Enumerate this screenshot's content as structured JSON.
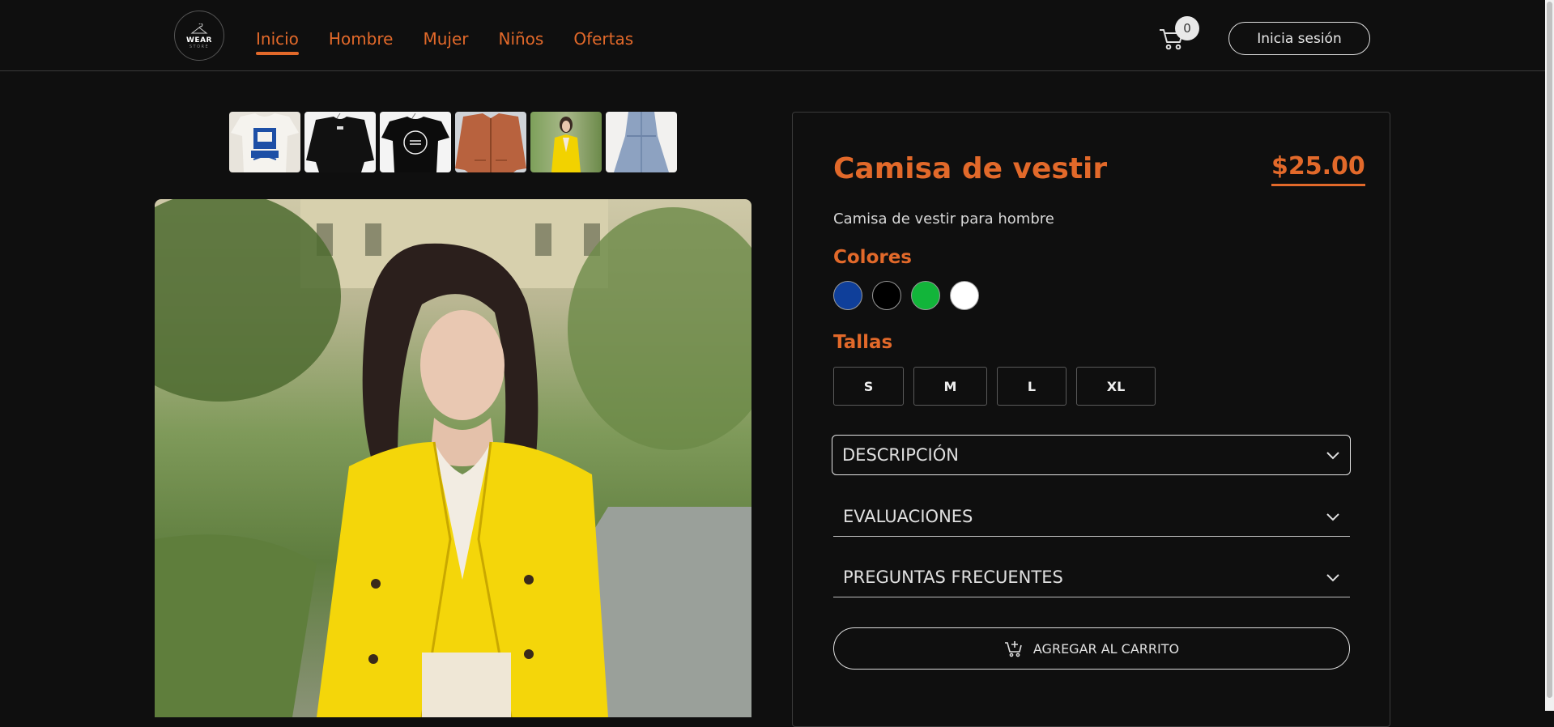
{
  "header": {
    "logo": {
      "brand": "WEAR",
      "sub": "STORE"
    },
    "nav": [
      {
        "label": "Inicio",
        "active": true
      },
      {
        "label": "Hombre",
        "active": false
      },
      {
        "label": "Mujer",
        "active": false
      },
      {
        "label": "Niños",
        "active": false
      },
      {
        "label": "Ofertas",
        "active": false
      }
    ],
    "cart_count": "0",
    "login_label": "Inicia sesión"
  },
  "gallery": {
    "thumbnails": [
      "white-tshirt-original",
      "black-sweater",
      "black-tshirt-705",
      "orange-bomber-jacket",
      "yellow-blazer-woman",
      "denim-dress"
    ],
    "main_image": "woman-yellow-blazer-photo"
  },
  "product": {
    "title": "Camisa de vestir",
    "price": "$25.00",
    "description": "Camisa de vestir para hombre",
    "colors_label": "Colores",
    "colors": [
      "#0f3f9a",
      "#000000",
      "#12b53a",
      "#ffffff"
    ],
    "sizes_label": "Tallas",
    "sizes": [
      "S",
      "M",
      "L",
      "XL"
    ],
    "accordions": [
      {
        "label": "DESCRIPCIÓN"
      },
      {
        "label": "EVALUACIONES"
      },
      {
        "label": "PREGUNTAS FRECUENTES"
      }
    ],
    "add_to_cart": "AGREGAR AL CARRITO"
  },
  "theme": {
    "accent": "#e2692a",
    "background": "#0f0f0f"
  }
}
